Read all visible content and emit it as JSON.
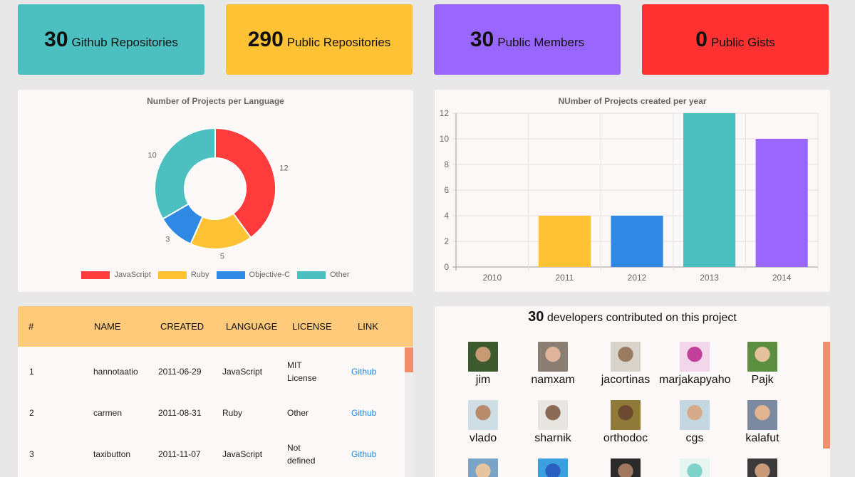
{
  "stats": [
    {
      "number": "30",
      "label": "Github Repositories",
      "color": "#4cc0c1"
    },
    {
      "number": "290",
      "label": "Public Repositories",
      "color": "#ffc234"
    },
    {
      "number": "30",
      "label": "Public Members",
      "color": "#9966ff"
    },
    {
      "number": "0",
      "label": "Public Gists",
      "color": "#ff3131"
    }
  ],
  "language_chart": {
    "title": "Number of Projects per Language"
  },
  "year_chart": {
    "title": "NUmber of Projects created per year"
  },
  "chart_data": [
    {
      "type": "pie",
      "title": "Number of Projects per Language",
      "categories": [
        "JavaScript",
        "Ruby",
        "Objective-C",
        "Other"
      ],
      "values": [
        12,
        5,
        3,
        10
      ],
      "colors": [
        "#ff3b3b",
        "#ffc234",
        "#2f88e3",
        "#4cc0c1"
      ],
      "legend": "bottom"
    },
    {
      "type": "bar",
      "title": "NUmber of Projects created per year",
      "categories": [
        "2010",
        "2011",
        "2012",
        "2013",
        "2014"
      ],
      "values": [
        0,
        4,
        4,
        12,
        10
      ],
      "colors": [
        "#ff3b3b",
        "#ffc234",
        "#2f88e3",
        "#4cc0c1",
        "#9966ff"
      ],
      "ylim": [
        0,
        12
      ],
      "yticks": [
        0,
        2,
        4,
        6,
        8,
        10,
        12
      ],
      "grid": true
    }
  ],
  "table": {
    "headers": [
      "#",
      "NAME",
      "CREATED",
      "LANGUAGE",
      "LICENSE",
      "LINK"
    ],
    "rows": [
      {
        "id": "1",
        "name": "hannotaatio",
        "created": "2011-06-29",
        "language": "JavaScript",
        "license_l1": "MIT",
        "license_l2": "License",
        "link": "Github"
      },
      {
        "id": "2",
        "name": "carmen",
        "created": "2011-08-31",
        "language": "Ruby",
        "license_l1": "Other",
        "license_l2": "",
        "link": "Github"
      },
      {
        "id": "3",
        "name": "taxibutton",
        "created": "2011-11-07",
        "language": "JavaScript",
        "license_l1": "Not",
        "license_l2": "defined",
        "link": "Github"
      }
    ]
  },
  "developers": {
    "count": "30",
    "title_suffix": "developers contributed on this project",
    "people": [
      {
        "name": "jim",
        "avatar": [
          "#3c5a2e",
          "#c89a74"
        ]
      },
      {
        "name": "namxam",
        "avatar": [
          "#8a7d72",
          "#e0b49a"
        ]
      },
      {
        "name": "jacortinas",
        "avatar": [
          "#d8d4cc",
          "#9b7b5f"
        ]
      },
      {
        "name": "marjakapyaho",
        "avatar": [
          "#f1d7e9",
          "#c2409a"
        ]
      },
      {
        "name": "Pajk",
        "avatar": [
          "#5b8f3f",
          "#e4c09c"
        ]
      },
      {
        "name": "vlado",
        "avatar": [
          "#cfdde4",
          "#b98a6b"
        ]
      },
      {
        "name": "sharnik",
        "avatar": [
          "#e8e6e0",
          "#8a6a55"
        ]
      },
      {
        "name": "orthodoc",
        "avatar": [
          "#8f7a3a",
          "#6b4a30"
        ]
      },
      {
        "name": "cgs",
        "avatar": [
          "#c4d6e0",
          "#d6a98a"
        ]
      },
      {
        "name": "kalafut",
        "avatar": [
          "#7b8aa0",
          "#e2b58e"
        ]
      },
      {
        "name": "",
        "avatar": [
          "#7aa3c8",
          "#e6c49f"
        ]
      },
      {
        "name": "",
        "avatar": [
          "#3aa0e0",
          "#2b5fbf"
        ]
      },
      {
        "name": "",
        "avatar": [
          "#2a2a2a",
          "#a07860"
        ]
      },
      {
        "name": "",
        "avatar": [
          "#e6f4f2",
          "#7fd3c8"
        ]
      },
      {
        "name": "",
        "avatar": [
          "#3b3b3b",
          "#c99a7a"
        ]
      }
    ]
  }
}
